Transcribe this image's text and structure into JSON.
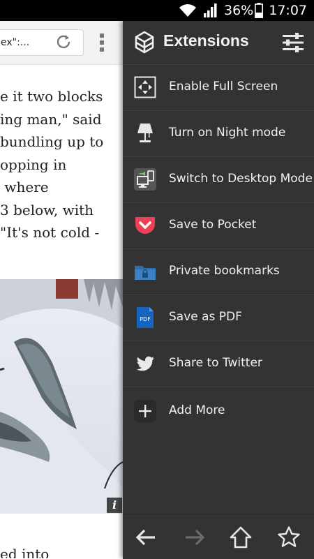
{
  "status_bar": {
    "battery": "36%",
    "time": "17:07",
    "icons": [
      "wifi-icon",
      "signal-icon",
      "battery-icon"
    ]
  },
  "browser": {
    "url_text": "ex\":...",
    "article_lines": [
      "e it two blocks",
      "ing man,\" said",
      "bundling up to",
      "opping in",
      " where",
      "3 below, with",
      "\"It's not cold -"
    ],
    "photo_badge": "i",
    "article_bottom": "ed into"
  },
  "panel": {
    "title": "Extensions",
    "items": [
      {
        "label": "Enable Full Screen",
        "icon": "fullscreen-icon"
      },
      {
        "label": "Turn on Night mode",
        "icon": "lamp-icon"
      },
      {
        "label": "Switch to Desktop Mode",
        "icon": "desktop-mode-icon"
      },
      {
        "label": "Save to Pocket",
        "icon": "pocket-icon"
      },
      {
        "label": "Private bookmarks",
        "icon": "locked-folder-icon"
      },
      {
        "label": "Save as PDF",
        "icon": "pdf-icon"
      },
      {
        "label": "Share to Twitter",
        "icon": "twitter-icon"
      },
      {
        "label": "Add More",
        "icon": "add-icon"
      }
    ],
    "pdf_icon_text": "PDF"
  },
  "colors": {
    "panel_bg": "#333333",
    "pocket_red": "#ef4056",
    "folder_blue": "#2f6ea8",
    "pdf_blue": "#1565c0"
  }
}
